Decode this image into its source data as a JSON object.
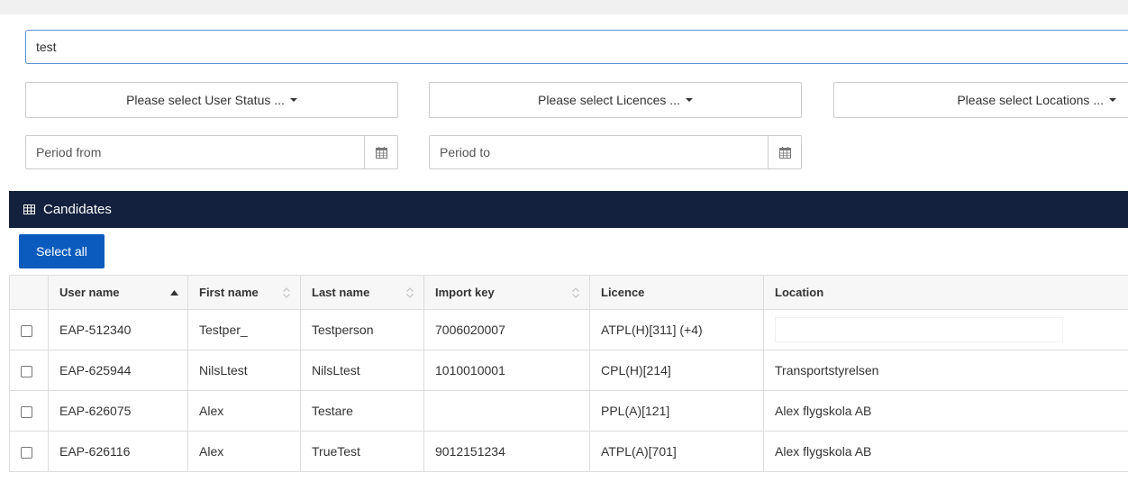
{
  "search": {
    "value": "test"
  },
  "filters": {
    "user_status": "Please select User Status ...",
    "licences": "Please select Licences ...",
    "locations": "Please select Locations ..."
  },
  "period": {
    "from_placeholder": "Period from",
    "to_placeholder": "Period to",
    "calendar_icon": "calendar-icon"
  },
  "panel": {
    "title": "Candidates",
    "icon": "grid-icon"
  },
  "select_all_label": "Select all",
  "colors": {
    "header_bg": "#13213f",
    "button_bg": "#0a5bbd",
    "input_focus": "#5b8fd6"
  },
  "table": {
    "columns": [
      "User name",
      "First name",
      "Last name",
      "Import key",
      "Licence",
      "Location"
    ],
    "sorted_column": "User name",
    "sort_direction": "ascending",
    "rows": [
      {
        "user_name": "EAP-512340",
        "first_name": "Testper_",
        "last_name": "Testperson",
        "import_key": "7006020007",
        "licence": "ATPL(H)[311] (+4)",
        "location": ""
      },
      {
        "user_name": "EAP-625944",
        "first_name": "NilsLtest",
        "last_name": "NilsLtest",
        "import_key": "1010010001",
        "licence": "CPL(H)[214]",
        "location": "Transportstyrelsen"
      },
      {
        "user_name": "EAP-626075",
        "first_name": "Alex",
        "last_name": "Testare",
        "import_key": "",
        "licence": "PPL(A)[121]",
        "location": "Alex flygskola AB"
      },
      {
        "user_name": "EAP-626116",
        "first_name": "Alex",
        "last_name": "TrueTest",
        "import_key": "9012151234",
        "licence": "ATPL(A)[701]",
        "location": "Alex flygskola AB"
      }
    ]
  }
}
